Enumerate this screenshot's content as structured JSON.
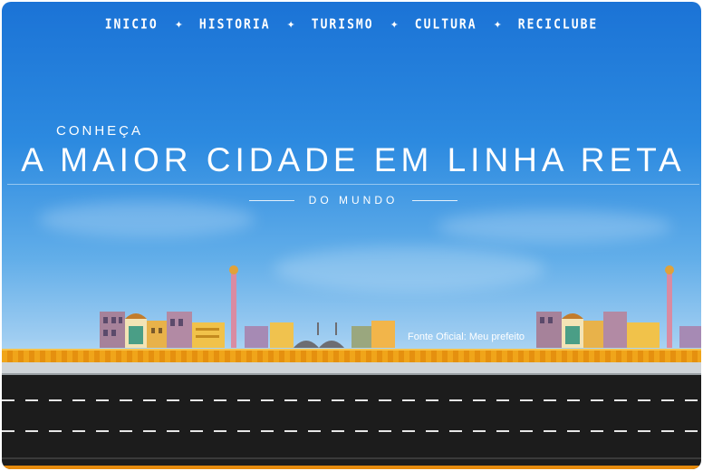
{
  "nav": {
    "items": [
      {
        "label": "INICIO"
      },
      {
        "label": "HISTORIA"
      },
      {
        "label": "TURISMO"
      },
      {
        "label": "CULTURA"
      },
      {
        "label": "RECICLUBE"
      }
    ],
    "separator": "✦"
  },
  "hero": {
    "kicker": "CONHEÇA",
    "title": "A MAIOR CIDADE EM LINHA RETA",
    "subtitle": "DO MUNDO"
  },
  "source_caption": "Fonte Oficial: Meu prefeito",
  "colors": {
    "sky_top": "#1b73d6",
    "sky_bottom": "#c5e2f6",
    "road": "#1c1c1c",
    "strip": "#f0a51a"
  }
}
